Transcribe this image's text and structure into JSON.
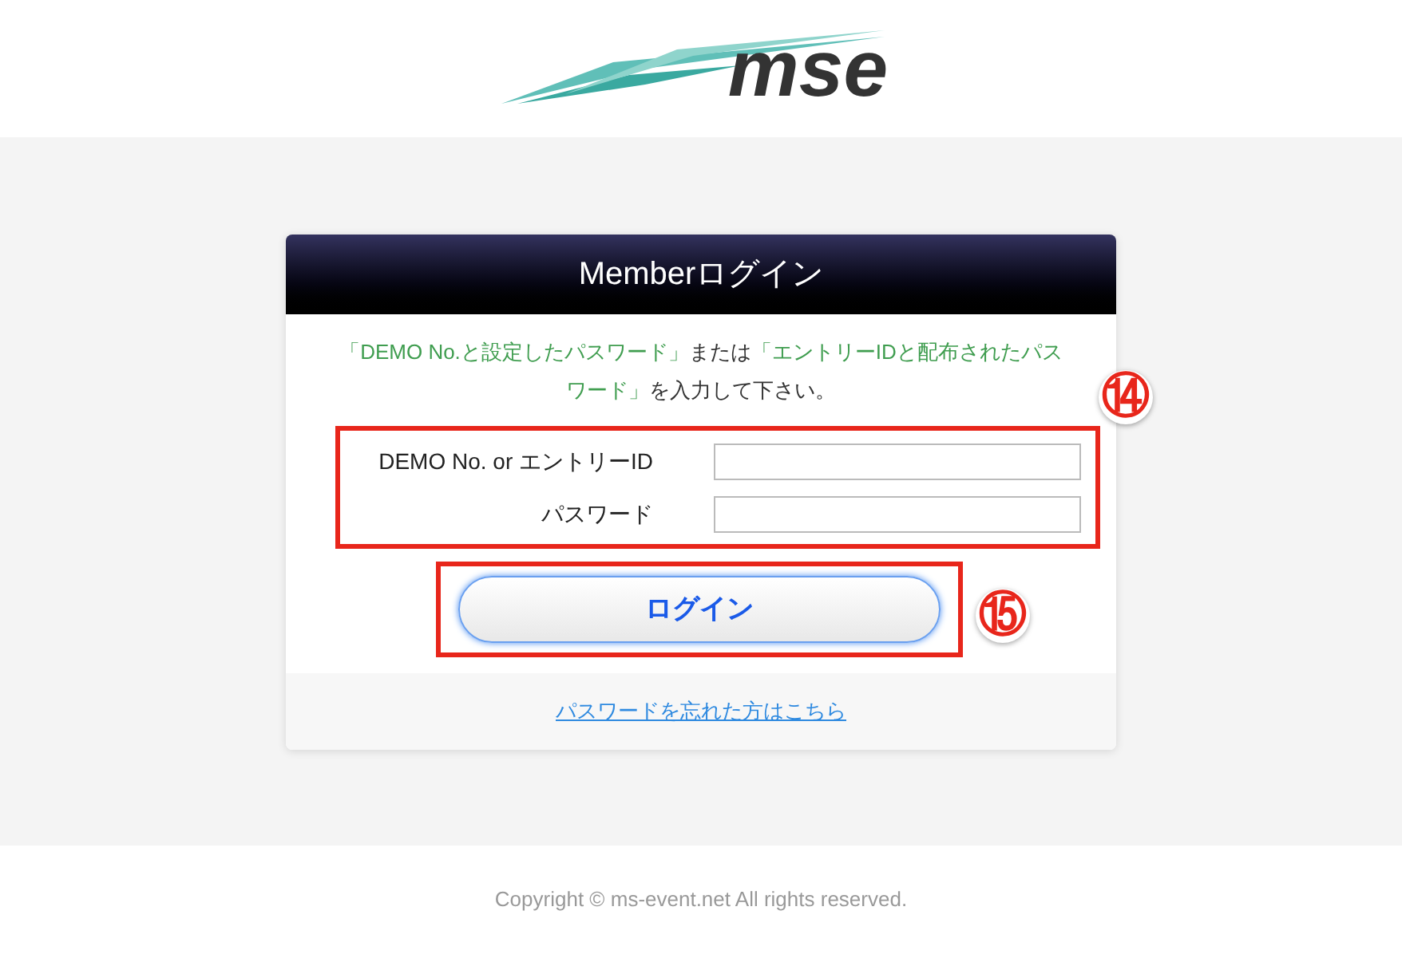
{
  "logo": {
    "text": "mse"
  },
  "login_card": {
    "title": "Memberログイン",
    "instructions": [
      {
        "text": "「DEMO No.と設定したパスワード」",
        "color": "#3f9d4f"
      },
      {
        "text": "または",
        "color": "#333333"
      },
      {
        "text": "「エントリーIDと配布されたパスワード」",
        "color": "#3f9d4f"
      },
      {
        "text": "を入力して下さい。",
        "color": "#333333"
      }
    ],
    "fields": [
      {
        "label": "DEMO No. or エントリーID"
      },
      {
        "label": "パスワード"
      }
    ],
    "fields_callout": "⑭",
    "login_button": "ログイン",
    "button_callout": "⑮",
    "forgot_link": "パスワードを忘れた方はこちら"
  },
  "footer": {
    "copyright": "Copyright © ms-event.net All rights reserved."
  }
}
